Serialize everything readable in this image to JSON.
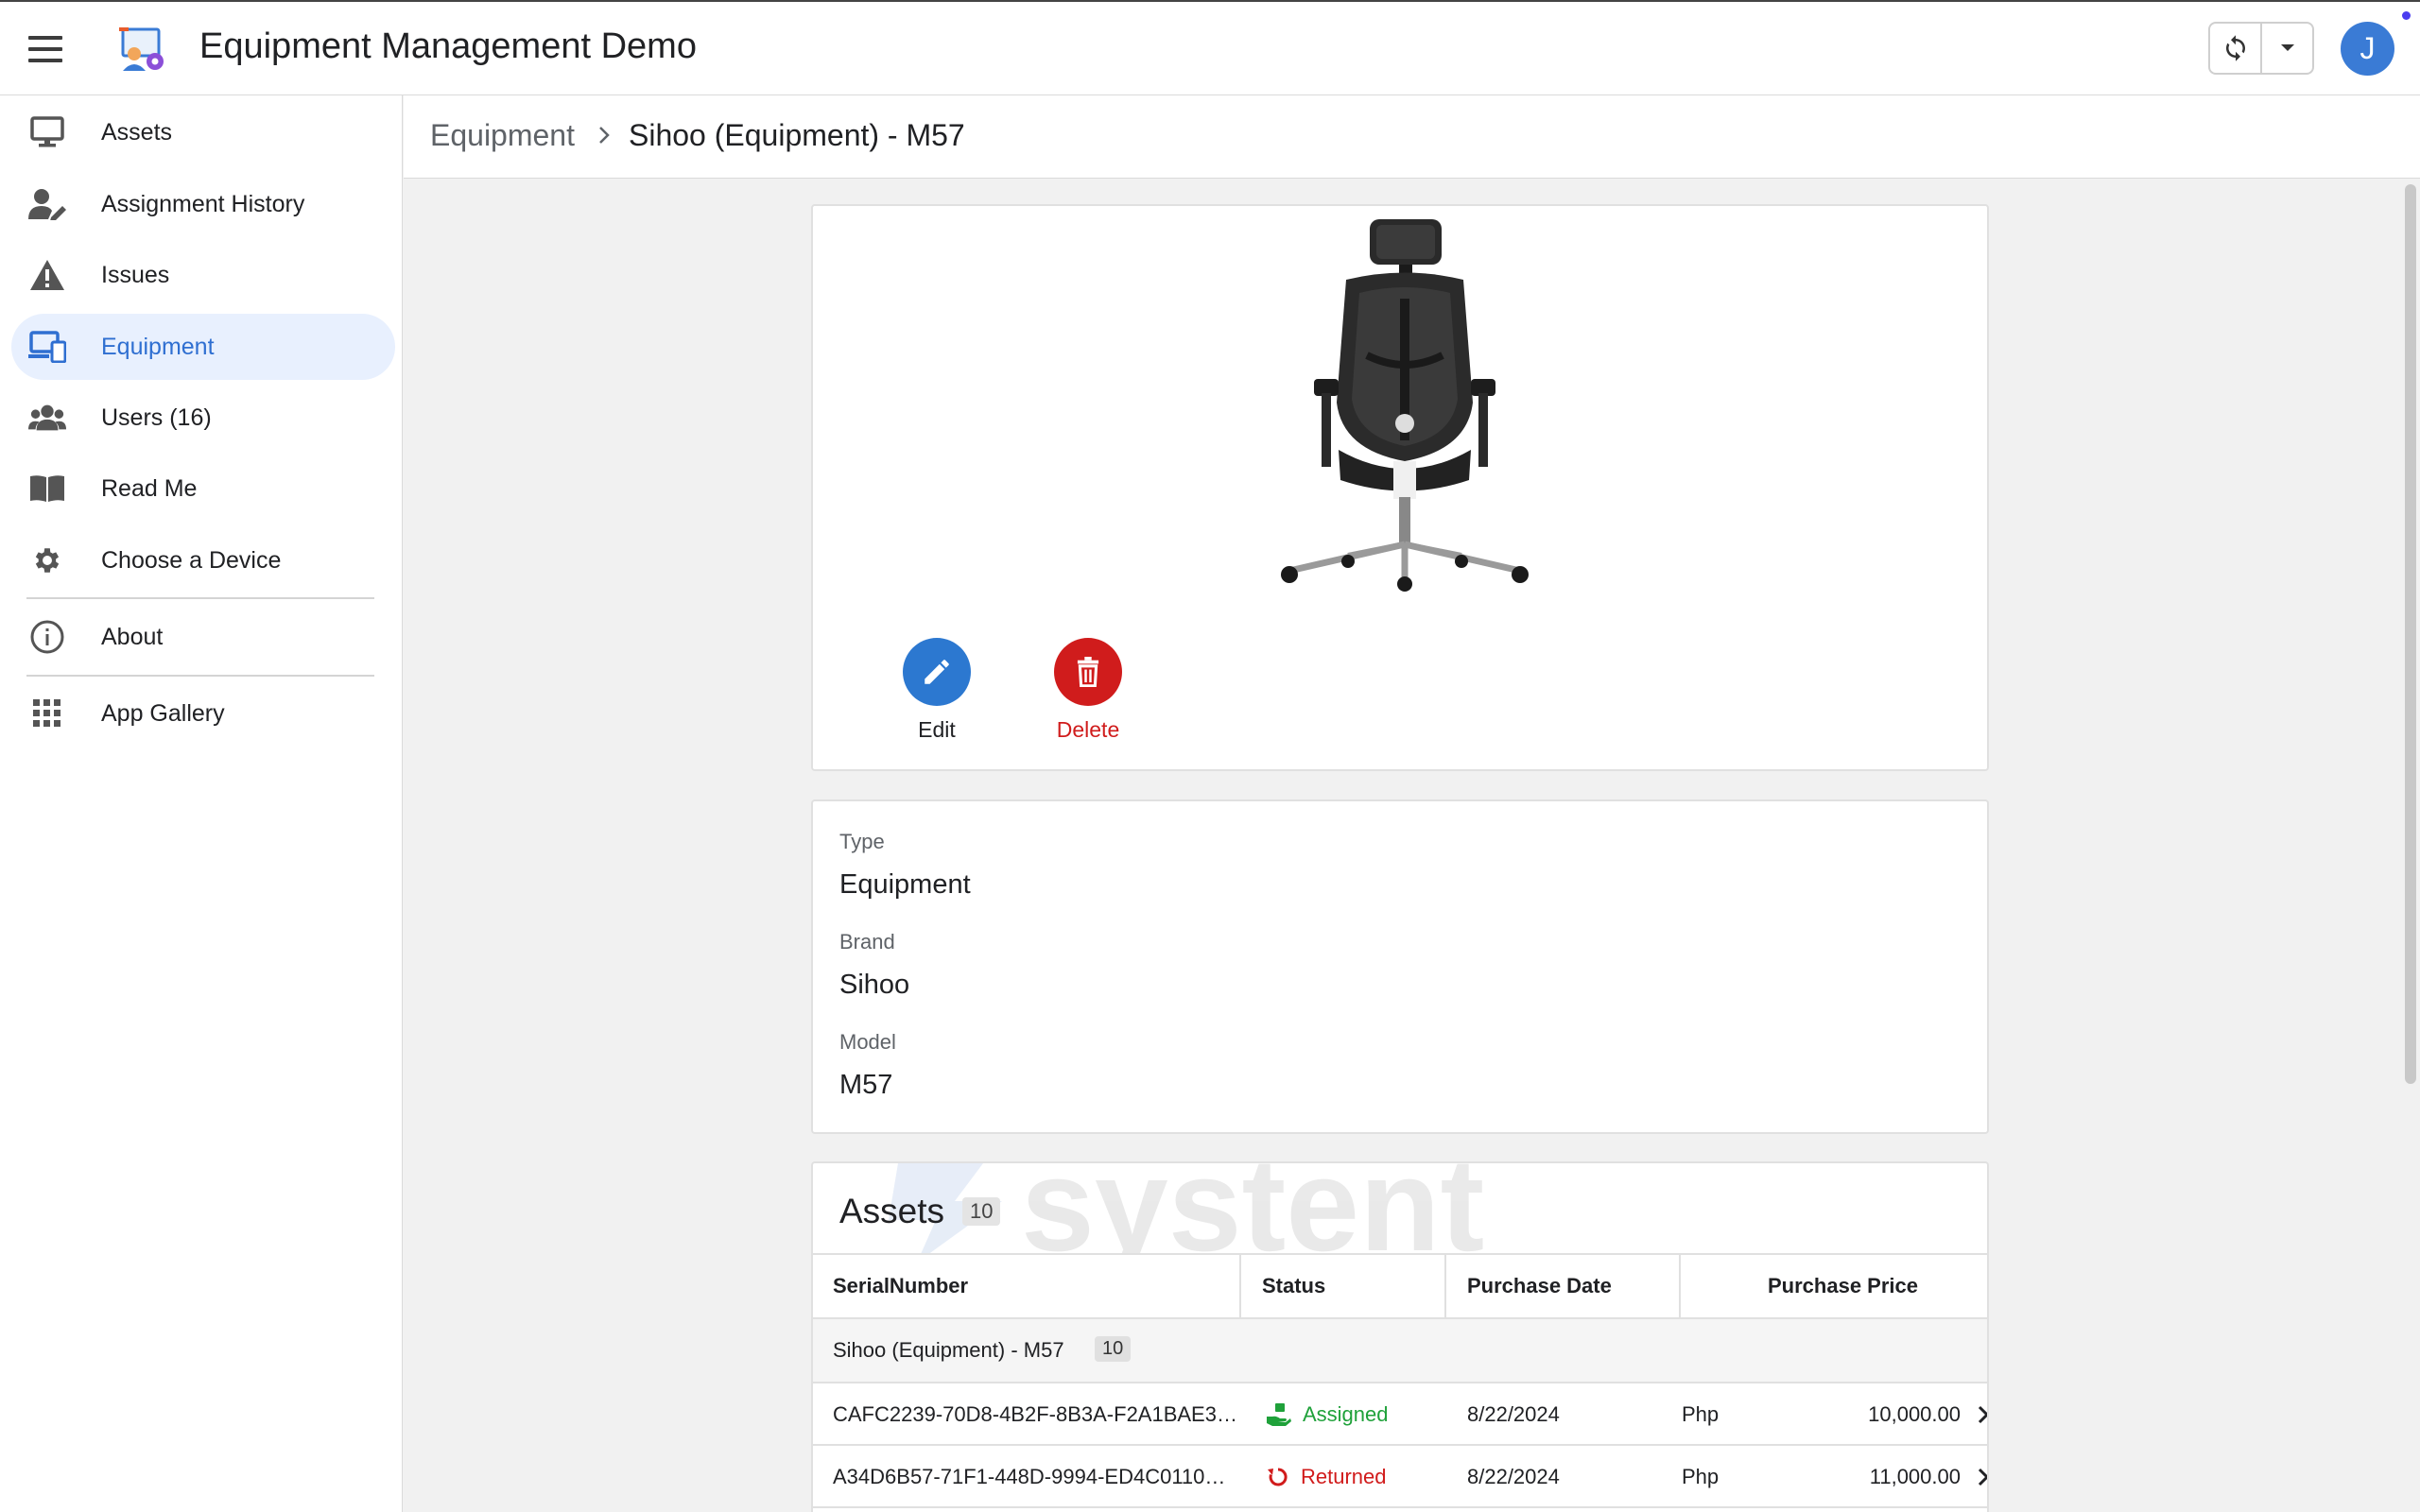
{
  "app": {
    "title": "Equipment Management Demo",
    "user_initial": "J"
  },
  "sidebar": {
    "items": [
      {
        "label": "Assets",
        "icon": "monitor-icon"
      },
      {
        "label": "Assignment History",
        "icon": "user-edit-icon"
      },
      {
        "label": "Issues",
        "icon": "warning-icon"
      },
      {
        "label": "Equipment",
        "icon": "devices-icon",
        "active": true
      },
      {
        "label": "Users (16)",
        "icon": "users-icon"
      },
      {
        "label": "Read Me",
        "icon": "book-icon"
      },
      {
        "label": "Choose a Device",
        "icon": "gear-icon"
      },
      {
        "label": "About",
        "icon": "info-icon"
      },
      {
        "label": "App Gallery",
        "icon": "grid-icon"
      }
    ]
  },
  "breadcrumb": {
    "root": "Equipment",
    "current": "Sihoo (Equipment) - M57"
  },
  "detail": {
    "actions": {
      "edit": "Edit",
      "delete": "Delete"
    },
    "fields": {
      "type_label": "Type",
      "type_value": "Equipment",
      "brand_label": "Brand",
      "brand_value": "Sihoo",
      "model_label": "Model",
      "model_value": "M57"
    }
  },
  "assets": {
    "title": "Assets",
    "count": "10",
    "watermark": "systent",
    "columns": {
      "serial": "SerialNumber",
      "status": "Status",
      "date": "Purchase Date",
      "price": "Purchase Price"
    },
    "group": {
      "label": "Sihoo (Equipment) - M57",
      "count": "10"
    },
    "rows": [
      {
        "serial": "CAFC2239-70D8-4B2F-8B3A-F2A1BAE3…",
        "status": "Assigned",
        "date": "8/22/2024",
        "currency": "Php",
        "price": "10,000.00"
      },
      {
        "serial": "A34D6B57-71F1-448D-9994-ED4C0110…",
        "status": "Returned",
        "date": "8/22/2024",
        "currency": "Php",
        "price": "11,000.00"
      }
    ]
  },
  "colors": {
    "accent": "#2f6fd1",
    "edit": "#2c78d0",
    "delete": "#d01c1c",
    "assigned": "#1fa13a",
    "returned": "#d11b1b"
  }
}
